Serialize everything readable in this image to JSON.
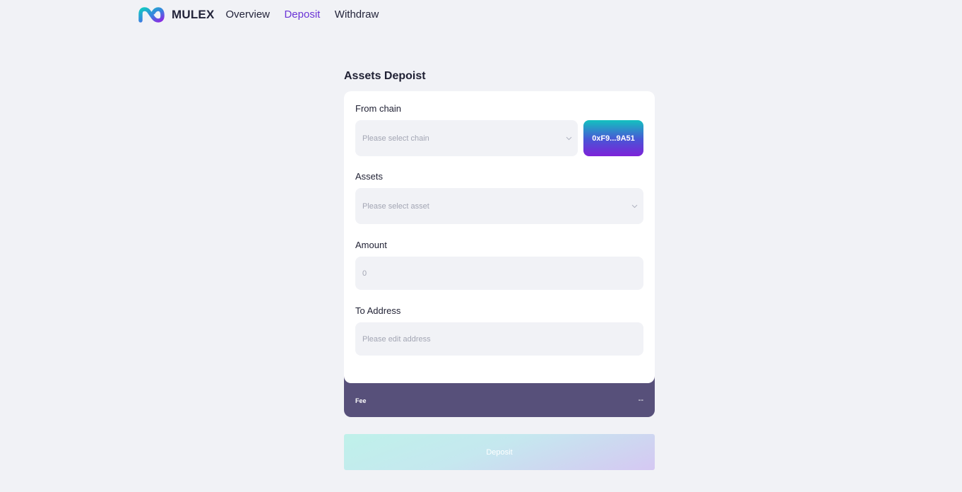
{
  "header": {
    "brand": "MULEX",
    "nav": [
      {
        "label": "Overview",
        "active": false
      },
      {
        "label": "Deposit",
        "active": true
      },
      {
        "label": "Withdraw",
        "active": false
      }
    ],
    "accent_color": "#6b34d6"
  },
  "main": {
    "title": "Assets Depoist",
    "from_chain": {
      "label": "From chain",
      "placeholder": "Please select chain",
      "wallet_address": "0xF9...9A51"
    },
    "assets": {
      "label": "Assets",
      "placeholder": "Please select asset"
    },
    "amount": {
      "label": "Amount",
      "placeholder": "0"
    },
    "to_address": {
      "label": "To Address",
      "placeholder": "Please edit address"
    },
    "fee": {
      "label": "Fee",
      "value": "--"
    },
    "submit_label": "Deposit"
  },
  "icons": {
    "logo": "mulex-infinity-logo-icon",
    "select_arrow": "chevron-down-icon"
  }
}
